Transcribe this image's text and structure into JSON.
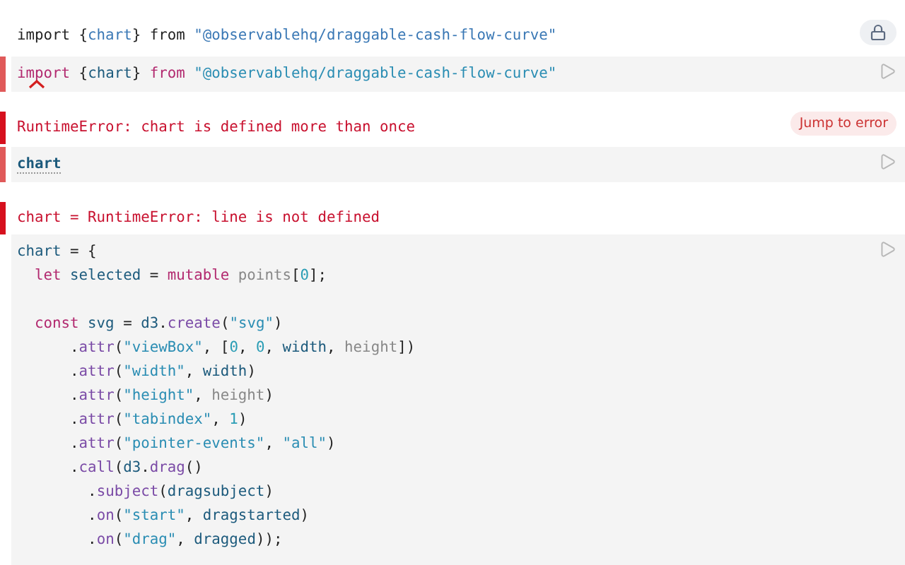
{
  "cells": [
    {
      "kind": "output",
      "locked": true,
      "lines": [
        {
          "tokens": [
            {
              "kind": "plain",
              "text": "import {"
            },
            {
              "kind": "ref",
              "text": "chart"
            },
            {
              "kind": "plain",
              "text": "} from "
            },
            {
              "kind": "ref",
              "text": "\"@observablehq/draggable-cash-flow-curve\""
            }
          ]
        }
      ]
    },
    {
      "kind": "editor",
      "flagged": true,
      "error_marker": true,
      "lines": [
        {
          "tokens": [
            {
              "kind": "kw",
              "text": "import"
            },
            {
              "kind": "plain",
              "text": " {"
            },
            {
              "kind": "var",
              "text": "chart"
            },
            {
              "kind": "plain",
              "text": "} "
            },
            {
              "kind": "kw",
              "text": "from "
            },
            {
              "kind": "str",
              "text": "\"@observablehq/draggable-cash-flow-curve\""
            }
          ]
        }
      ]
    },
    {
      "kind": "error",
      "text": "RuntimeError: chart is defined more than once",
      "action": "Jump to error"
    },
    {
      "kind": "editor",
      "flagged": true,
      "lines": [
        {
          "tokens": [
            {
              "kind": "def",
              "text": "chart"
            }
          ]
        }
      ]
    },
    {
      "kind": "error",
      "text": "chart = RuntimeError: line is not defined"
    },
    {
      "kind": "editor",
      "flagged": false,
      "lines": [
        {
          "tokens": [
            {
              "kind": "var",
              "text": "chart"
            },
            {
              "kind": "plain",
              "text": " = {"
            }
          ]
        },
        {
          "tokens": [
            {
              "kind": "kw",
              "text": "  let "
            },
            {
              "kind": "var",
              "text": "selected"
            },
            {
              "kind": "plain",
              "text": " = "
            },
            {
              "kind": "kw",
              "text": "mutable "
            },
            {
              "kind": "muted",
              "text": "points"
            },
            {
              "kind": "plain",
              "text": "["
            },
            {
              "kind": "num",
              "text": "0"
            },
            {
              "kind": "plain",
              "text": "];"
            }
          ]
        },
        {
          "blank_before": true,
          "tokens": [
            {
              "kind": "kw",
              "text": "  const "
            },
            {
              "kind": "var",
              "text": "svg"
            },
            {
              "kind": "plain",
              "text": " = "
            },
            {
              "kind": "var",
              "text": "d3"
            },
            {
              "kind": "plain",
              "text": "."
            },
            {
              "kind": "fn",
              "text": "create"
            },
            {
              "kind": "plain",
              "text": "("
            },
            {
              "kind": "str",
              "text": "\"svg\""
            },
            {
              "kind": "plain",
              "text": ")"
            }
          ]
        },
        {
          "tokens": [
            {
              "kind": "plain",
              "text": "      ."
            },
            {
              "kind": "fn",
              "text": "attr"
            },
            {
              "kind": "plain",
              "text": "("
            },
            {
              "kind": "str",
              "text": "\"viewBox\""
            },
            {
              "kind": "plain",
              "text": ", ["
            },
            {
              "kind": "num",
              "text": "0"
            },
            {
              "kind": "plain",
              "text": ", "
            },
            {
              "kind": "num",
              "text": "0"
            },
            {
              "kind": "plain",
              "text": ", "
            },
            {
              "kind": "var",
              "text": "width"
            },
            {
              "kind": "plain",
              "text": ", "
            },
            {
              "kind": "muted",
              "text": "height"
            },
            {
              "kind": "plain",
              "text": "])"
            }
          ]
        },
        {
          "tokens": [
            {
              "kind": "plain",
              "text": "      ."
            },
            {
              "kind": "fn",
              "text": "attr"
            },
            {
              "kind": "plain",
              "text": "("
            },
            {
              "kind": "str",
              "text": "\"width\""
            },
            {
              "kind": "plain",
              "text": ", "
            },
            {
              "kind": "var",
              "text": "width"
            },
            {
              "kind": "plain",
              "text": ")"
            }
          ]
        },
        {
          "tokens": [
            {
              "kind": "plain",
              "text": "      ."
            },
            {
              "kind": "fn",
              "text": "attr"
            },
            {
              "kind": "plain",
              "text": "("
            },
            {
              "kind": "str",
              "text": "\"height\""
            },
            {
              "kind": "plain",
              "text": ", "
            },
            {
              "kind": "muted",
              "text": "height"
            },
            {
              "kind": "plain",
              "text": ")"
            }
          ]
        },
        {
          "tokens": [
            {
              "kind": "plain",
              "text": "      ."
            },
            {
              "kind": "fn",
              "text": "attr"
            },
            {
              "kind": "plain",
              "text": "("
            },
            {
              "kind": "str",
              "text": "\"tabindex\""
            },
            {
              "kind": "plain",
              "text": ", "
            },
            {
              "kind": "num",
              "text": "1"
            },
            {
              "kind": "plain",
              "text": ")"
            }
          ]
        },
        {
          "tokens": [
            {
              "kind": "plain",
              "text": "      ."
            },
            {
              "kind": "fn",
              "text": "attr"
            },
            {
              "kind": "plain",
              "text": "("
            },
            {
              "kind": "str",
              "text": "\"pointer-events\""
            },
            {
              "kind": "plain",
              "text": ", "
            },
            {
              "kind": "str",
              "text": "\"all\""
            },
            {
              "kind": "plain",
              "text": ")"
            }
          ]
        },
        {
          "tokens": [
            {
              "kind": "plain",
              "text": "      ."
            },
            {
              "kind": "fn",
              "text": "call"
            },
            {
              "kind": "plain",
              "text": "("
            },
            {
              "kind": "var",
              "text": "d3"
            },
            {
              "kind": "plain",
              "text": "."
            },
            {
              "kind": "fn",
              "text": "drag"
            },
            {
              "kind": "plain",
              "text": "()"
            }
          ]
        },
        {
          "tokens": [
            {
              "kind": "plain",
              "text": "        ."
            },
            {
              "kind": "fn",
              "text": "subject"
            },
            {
              "kind": "plain",
              "text": "("
            },
            {
              "kind": "var",
              "text": "dragsubject"
            },
            {
              "kind": "plain",
              "text": ")"
            }
          ]
        },
        {
          "tokens": [
            {
              "kind": "plain",
              "text": "        ."
            },
            {
              "kind": "fn",
              "text": "on"
            },
            {
              "kind": "plain",
              "text": "("
            },
            {
              "kind": "str",
              "text": "\"start\""
            },
            {
              "kind": "plain",
              "text": ", "
            },
            {
              "kind": "var",
              "text": "dragstarted"
            },
            {
              "kind": "plain",
              "text": ")"
            }
          ]
        },
        {
          "tokens": [
            {
              "kind": "plain",
              "text": "        ."
            },
            {
              "kind": "fn",
              "text": "on"
            },
            {
              "kind": "plain",
              "text": "("
            },
            {
              "kind": "str",
              "text": "\"drag\""
            },
            {
              "kind": "plain",
              "text": ", "
            },
            {
              "kind": "var",
              "text": "dragged"
            },
            {
              "kind": "plain",
              "text": "));"
            }
          ]
        }
      ]
    }
  ]
}
